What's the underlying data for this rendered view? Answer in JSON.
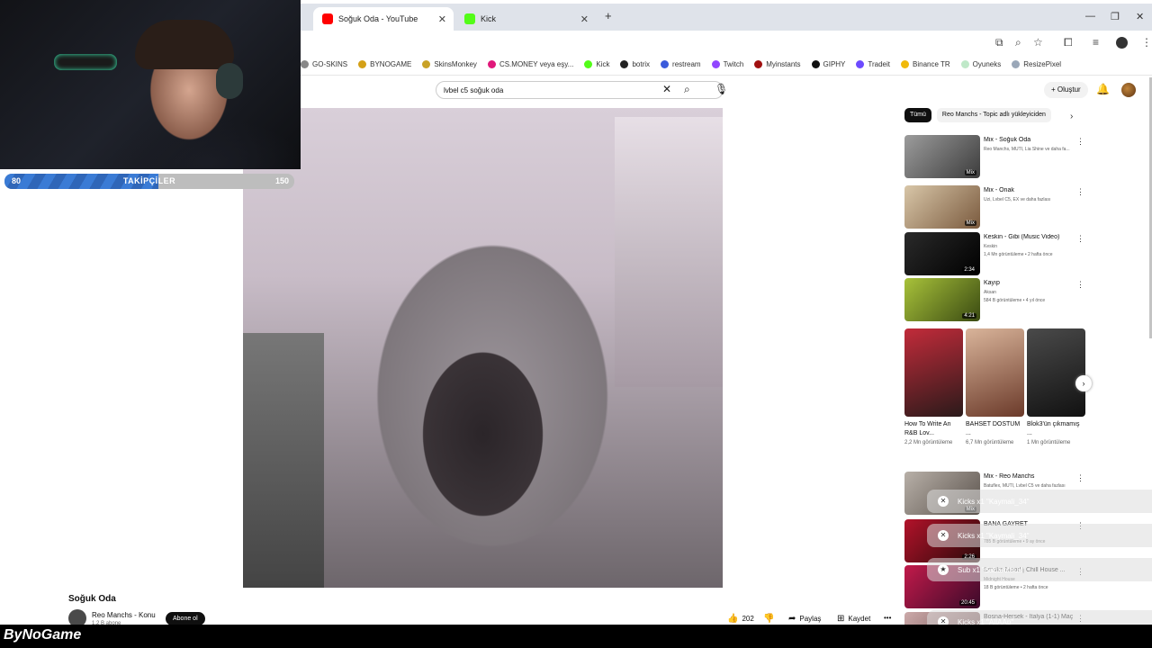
{
  "browser": {
    "tabs": [
      {
        "title": "Soğuk Oda - YouTube",
        "close": "✕"
      },
      {
        "title": "Kick",
        "close": "✕"
      }
    ],
    "new_tab": "+",
    "window_controls": [
      "—",
      "❐",
      "✕"
    ],
    "bookmarks": [
      {
        "label": "GO-SKINS",
        "color": "#888888"
      },
      {
        "label": "BYNOGAME",
        "color": "#d4a017"
      },
      {
        "label": "SkinsMonkey",
        "color": "#c9a227"
      },
      {
        "label": "CS.MONEY veya eşy...",
        "color": "#e0187a"
      },
      {
        "label": "Kick",
        "color": "#53fc18"
      },
      {
        "label": "botrix",
        "color": "#222222"
      },
      {
        "label": "restream",
        "color": "#3b5bdb"
      },
      {
        "label": "Twitch",
        "color": "#9146ff"
      },
      {
        "label": "Myinstants",
        "color": "#a01010"
      },
      {
        "label": "GIPHY",
        "color": "#111111"
      },
      {
        "label": "Tradeit",
        "color": "#6d4aff"
      },
      {
        "label": "Binance TR",
        "color": "#f0b90b"
      },
      {
        "label": "Oyuneks",
        "color": "#bfe8c8"
      },
      {
        "label": "ResizePixel",
        "color": "#9aa7b8"
      }
    ]
  },
  "youtube": {
    "search_value": "lvbel c5 soğuk oda",
    "create_label": "+ Oluştur",
    "video": {
      "title": "Soğuk Oda",
      "channel": "Reo Manchs - Konu",
      "subscribers": "1,2 B abone",
      "subscribe_label": "Abone ol",
      "likes": "202",
      "share_label": "Paylaş",
      "save_label": "Kaydet",
      "more_label": "•••"
    },
    "chips": [
      "Tümü",
      "Reo Manchs - Topic adlı yükleyiciden"
    ],
    "recommendations": [
      {
        "title": "Mix - Soğuk Oda",
        "sub": "Reo Manchs, MUTI, Lia Shine ve daha fa...",
        "meta": "",
        "badge": "Mix",
        "color1": "#9c9c9c",
        "color2": "#3c3c3c"
      },
      {
        "title": "Mix - Onak",
        "sub": "Uzi, Lvbel C5, EX ve daha fazlası",
        "meta": "",
        "badge": "Mix",
        "color1": "#d8c6a8",
        "color2": "#7a5a3e"
      },
      {
        "title": "Keskin - Gibi (Music Video)",
        "sub": "Keskin",
        "meta": "1,4 Mn görüntüleme • 2 hafta önce",
        "badge": "2:34",
        "color1": "#2a2a2a",
        "color2": "#000000"
      },
      {
        "title": "Kayıp",
        "sub": "Aksan",
        "meta": "584 B görüntüleme • 4 yıl önce",
        "badge": "4:21",
        "color1": "#a8c23a",
        "color2": "#3a4a12"
      }
    ],
    "shorts": [
      {
        "title": "How To Write An R&B Lov...",
        "views": "2,2 Mn görüntüleme",
        "color1": "#c22b3a",
        "color2": "#2a1a1a"
      },
      {
        "title": "BAHSET DOSTUM ...",
        "views": "6,7 Mn görüntüleme",
        "color1": "#d9b49a",
        "color2": "#6b3a2a"
      },
      {
        "title": "Blok3'ün çıkmamış ...",
        "views": "1 Mn görüntüleme",
        "color1": "#4a4a4a",
        "color2": "#111111"
      }
    ],
    "more_recs": [
      {
        "title": "Mix - Reo Manchs",
        "sub": "Batuflex, MUTI, Lvbel C5 ve daha fazlası",
        "meta": "",
        "badge": "Mix",
        "color1": "#b8b0a8",
        "color2": "#5a524c"
      },
      {
        "title": "BANA GAYRET",
        "sub": "",
        "meta": "785 B görüntüleme • 9 ay önce",
        "badge": "2:26",
        "color1": "#b2122a",
        "color2": "#2a0a0a"
      },
      {
        "title": "Smoke Mood | Chill House ...",
        "sub": "Midnight House",
        "meta": "18 B görüntüleme • 2 hafta önce",
        "badge": "20:45",
        "color1": "#c21a4a",
        "color2": "#3a0a2a"
      },
      {
        "title": "Bosna-Hersek - İtalya (1-1) Maç",
        "sub": "",
        "meta": "",
        "badge": "",
        "color1": "#caa",
        "color2": "#644"
      }
    ]
  },
  "overlay": {
    "follow_min": "80",
    "follow_label": "TAKİPÇİLER",
    "follow_max": "150",
    "follow_progress": 0.53,
    "brand": "ByNoGame",
    "alerts": [
      {
        "text": "Kicks x1 \"Kaymali_34\""
      },
      {
        "text": "Kicks x1 \"Kaymali_34\""
      },
      {
        "text": "Sub x1 \"Sabaroftruk\""
      },
      {
        "text": "Kicks x1 \"AlIAAp\""
      }
    ]
  }
}
